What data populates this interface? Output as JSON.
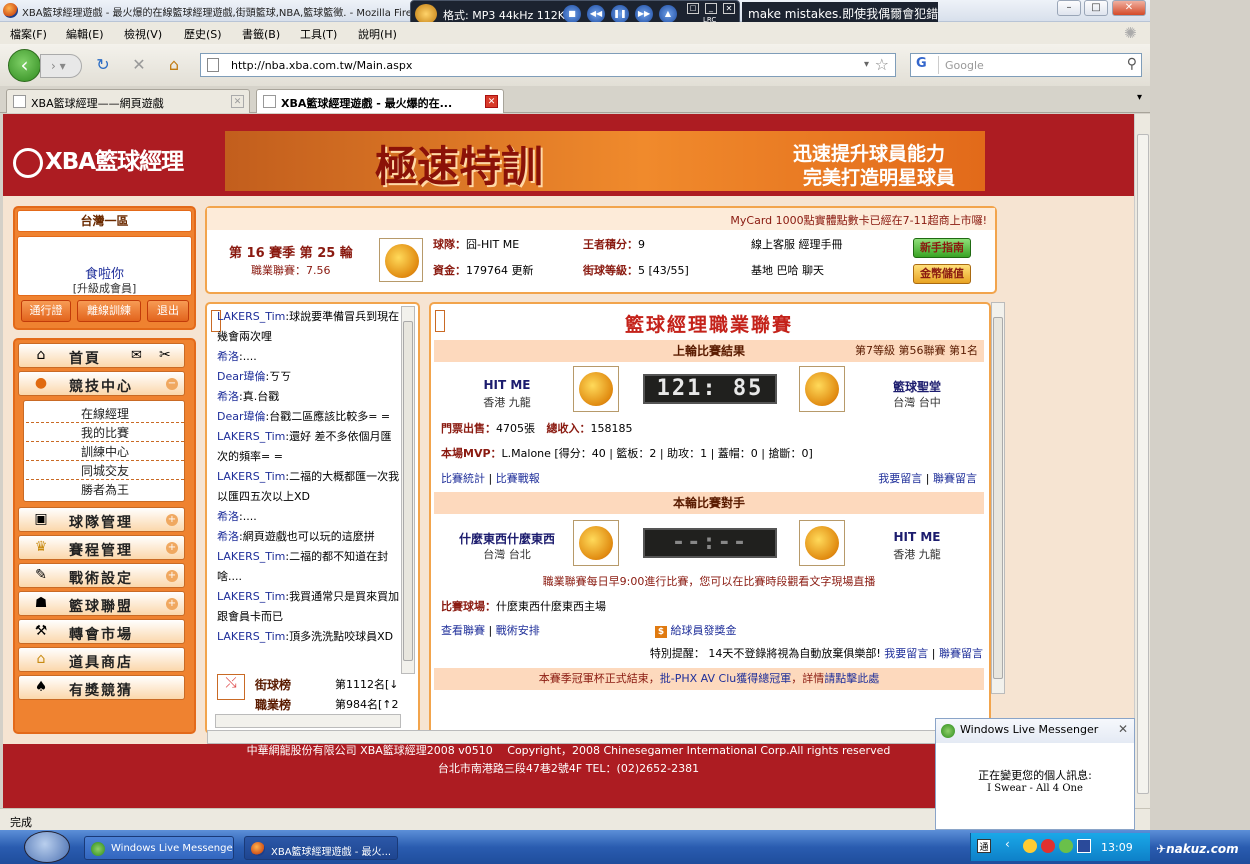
{
  "window": {
    "title": "XBA籃球經理遊戲 - 最火爆的在線籃球經理遊戲,街頭籃球,NBA,籃球籃徵. - Mozilla Firefox"
  },
  "player": {
    "format": "格式: MP3 44kHz 112K",
    "lrc": "LRC",
    "lyric": "make mistakes.即使我偶爾會犯錯"
  },
  "menubar": [
    "檔案(F)",
    "編輯(E)",
    "檢視(V)",
    "歷史(S)",
    "書籤(B)",
    "工具(T)",
    "說明(H)"
  ],
  "address": {
    "url": "http://nba.xba.com.tw/Main.aspx",
    "search_placeholder": "Google",
    "search_engine": "G"
  },
  "tabs": [
    {
      "label": "XBA籃球經理——網頁遊戲",
      "active": false
    },
    {
      "label": "XBA籃球經理遊戲 - 最火爆的在...",
      "active": true
    }
  ],
  "site": {
    "logo": "XBA籃球經理",
    "banner_title": "極速特訓",
    "banner_line1": "迅速提升球員能力",
    "banner_line2": "完美打造明星球員"
  },
  "userbox": {
    "server": "台灣一區",
    "username": "食啦你",
    "member_type": "[升級成會員]",
    "buttons": [
      "通行證",
      "離線訓練",
      "退出"
    ]
  },
  "nav": {
    "home": "首頁",
    "sections": [
      {
        "label": "競技中心",
        "icon": "basketball-icon",
        "expand": "−"
      },
      {
        "label": "球隊管理",
        "icon": "jersey-icon",
        "expand": "+"
      },
      {
        "label": "賽程管理",
        "icon": "trophy-icon",
        "expand": "+"
      },
      {
        "label": "戰術設定",
        "icon": "tactics-icon",
        "expand": "+"
      },
      {
        "label": "籃球聯盟",
        "icon": "league-icon",
        "expand": "+"
      },
      {
        "label": "轉會市場",
        "icon": "hammer-icon",
        "expand": ""
      },
      {
        "label": "道具商店",
        "icon": "shop-icon",
        "expand": ""
      },
      {
        "label": "有獎競猜",
        "icon": "spade-icon",
        "expand": ""
      }
    ],
    "sub_items": [
      "在線經理",
      "我的比賽",
      "訓練中心",
      "同城交友",
      "勝者為王"
    ]
  },
  "infobar": {
    "notice": "MyCard 1000點實體點數卡已經在7-11超商上市囉!",
    "season": "第 16 賽季 第 25 輪",
    "league": "職業聯賽：7.56",
    "team_label": "球隊：",
    "team_name": "囧-HIT ME",
    "funds_label": "資金：",
    "funds": "179764",
    "update": "更新",
    "king_label": "王者積分：",
    "king_points": "9",
    "street_label": "街球等級：",
    "street_level": "5 [43/55]",
    "links_row1": "線上客服 經理手冊",
    "links_row2": "基地 巴哈 聊天",
    "btn_guide": "新手指南",
    "btn_deposit": "金幣儲值"
  },
  "chat": [
    {
      "name": "LAKERS_Tim",
      "text": ":球說要準備冒兵到現在"
    },
    {
      "name": "",
      "text": "幾會兩次哩"
    },
    {
      "name": "希洛",
      "text": ":...."
    },
    {
      "name": "Dear瑋倫",
      "text": ":ㄎㄎ"
    },
    {
      "name": "希洛",
      "text": ":真.台戳"
    },
    {
      "name": "Dear瑋倫",
      "text": ":台戳二區應該比較多= ="
    },
    {
      "name": "LAKERS_Tim",
      "text": ":還好 差不多依個月匯"
    },
    {
      "name": "",
      "text": "次的頻率= ="
    },
    {
      "name": "LAKERS_Tim",
      "text": ":二福的大概都匯一次我"
    },
    {
      "name": "",
      "text": "以匯四五次以上XD"
    },
    {
      "name": "希洛",
      "text": ":...."
    },
    {
      "name": "希洛",
      "text": ":網頁遊戲也可以玩的這麼拼"
    },
    {
      "name": "LAKERS_Tim",
      "text": ":二福的都不知道在封"
    },
    {
      "name": "",
      "text": "啥...."
    },
    {
      "name": "LAKERS_Tim",
      "text": ":我買通常只是買來買加"
    },
    {
      "name": "",
      "text": "跟會員卡而已"
    },
    {
      "name": "LAKERS_Tim",
      "text": ":頂多洗洗點咬球員XD"
    }
  ],
  "ranks": [
    {
      "label": "街球榜",
      "value": "第1112名[↓"
    },
    {
      "label": "職業榜",
      "value": "第984名[↑2"
    }
  ],
  "league_panel": {
    "title": "籃球經理職業聯賽",
    "last_title": "上輪比賽結果",
    "last_info": "第7等級 第56聯賽 第1名",
    "home_team": "HIT ME",
    "home_city": "香港 九龍",
    "score": "121: 85",
    "away_team": "籃球聖堂",
    "away_city": "台灣 台中",
    "tickets_label": "門票出售：",
    "tickets": "4705張",
    "income_label": "總收入：",
    "income": "158185",
    "mvp_label": "本場MVP：",
    "mvp": "L.Malone [得分：40 | 籃板：2 | 助攻：1 | 蓋帽：0 | 搶斷：0]",
    "stats_link": "比賽統計",
    "report_link": "比賽戰報",
    "msg_link": "我要留言",
    "league_msg_link": "聯賽留言",
    "next_title": "本輪比賽對手",
    "next_home": "什麼東西什麼東西",
    "next_home_city": "台灣 台北",
    "next_score": "--:--",
    "next_away": "HIT ME",
    "next_away_city": "香港 九龍",
    "schedule_note": "職業聯賽每日早9:00進行比賽，您可以在比賽時段觀看文字現場直播",
    "venue_label": "比賽球場：",
    "venue": "什麼東西什麼東西主場",
    "view_league": "查看聯賽",
    "tactics": "戰術安排",
    "bonus": "給球員發獎金",
    "warning": "特別提醒： 14天不登錄將視為自動放棄俱樂部!",
    "champion_a": "本賽季冠軍杯正式結束，",
    "champion_b": "批-PHX AV Clu獲得總冠軍",
    "champion_c": "，詳情",
    "champion_d": "請點擊此處"
  },
  "footer": {
    "line1": "中華網龍股份有限公司 XBA籃球經理2008 v0510　 Copyright，2008 Chinesegamer International Corp.All rights reserved",
    "line2": "台北市南港路三段47巷2號4F TEL：(02)2652-2381"
  },
  "status": "完成",
  "messenger": {
    "title": "Windows Live Messenger",
    "line1": "正在變更您的個人訊息:",
    "line2": "I Swear - All 4 One"
  },
  "taskbar": {
    "items": [
      "Windows Live Messenger",
      "XBA籃球經理遊戲 - 最火..."
    ],
    "clock": "13:09",
    "watermark": "nakuz.com"
  }
}
